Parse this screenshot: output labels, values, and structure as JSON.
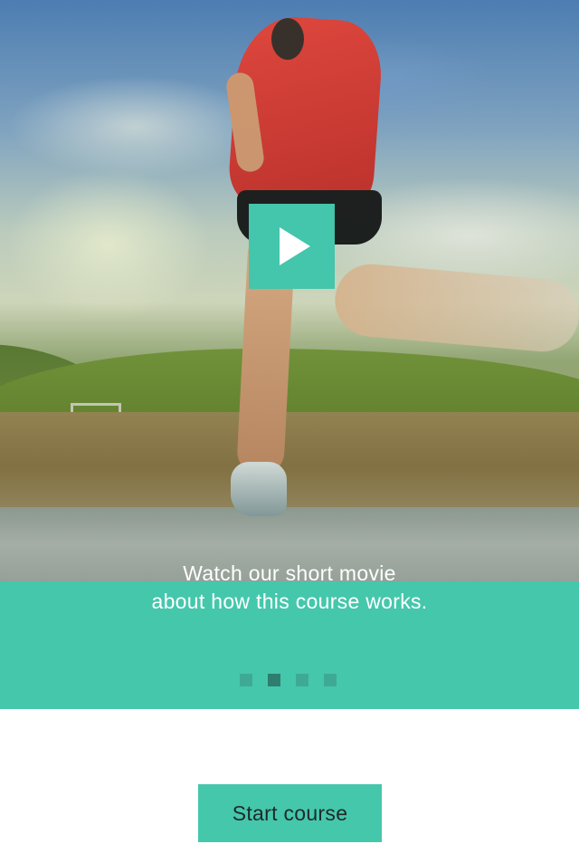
{
  "hero": {
    "image_name": "runner-on-trail-image",
    "play_icon": "play-icon"
  },
  "caption": {
    "line1": "Watch our short movie",
    "line2": "about how this course works."
  },
  "pager": {
    "total": 4,
    "current": 2
  },
  "start_button": {
    "label": "Start course"
  },
  "colors": {
    "accent": "#45c7ac",
    "dot_inactive": "#3eaa93",
    "dot_active": "#2e7e70"
  }
}
